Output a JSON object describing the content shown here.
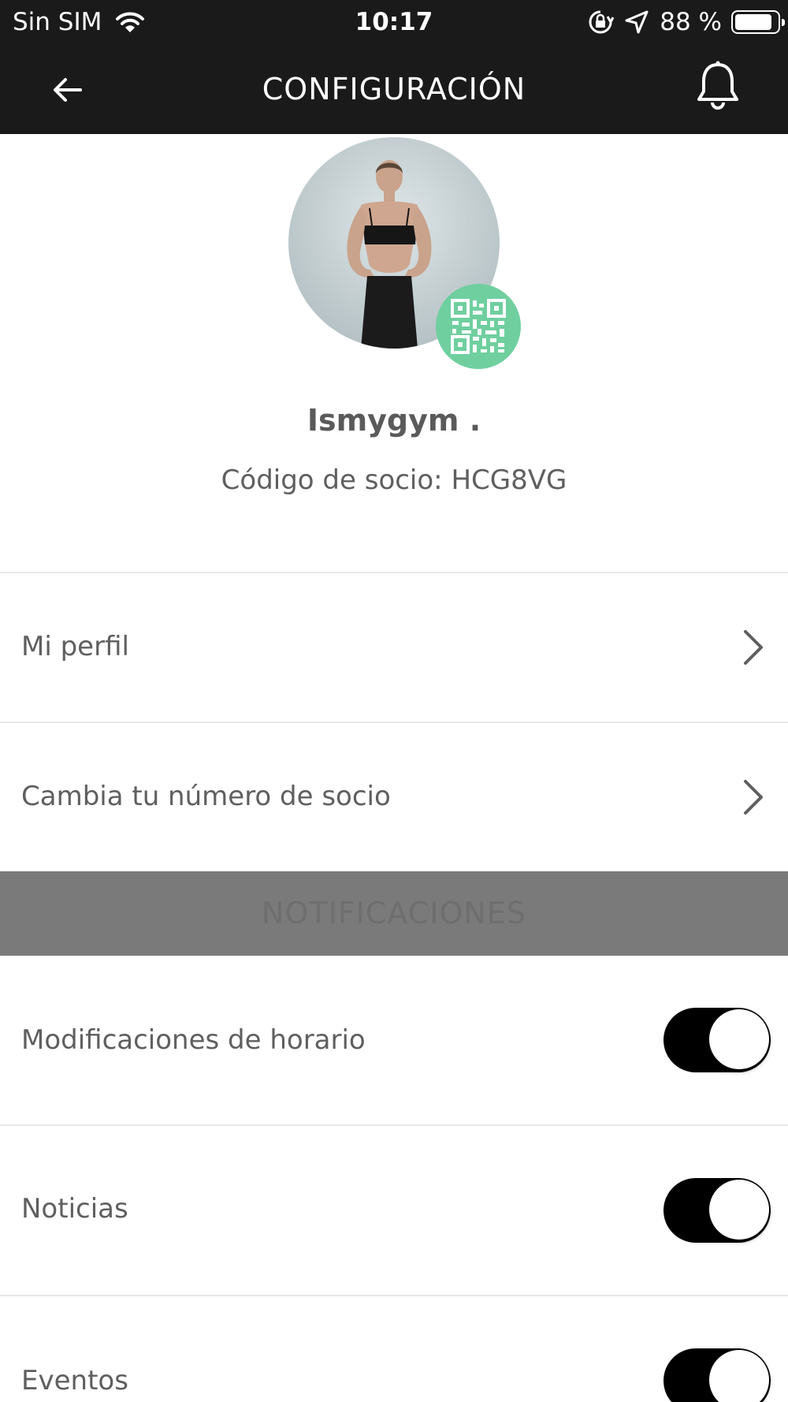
{
  "status_bar": {
    "carrier": "Sin SIM",
    "time": "10:17",
    "battery_percent": "88 %",
    "battery_level": 0.88
  },
  "nav": {
    "title": "CONFIGURACIÓN"
  },
  "profile": {
    "name": "Ismygym .",
    "member_code": "Código de socio: HCG8VG"
  },
  "menu": {
    "items": [
      {
        "label": "Mi perfil"
      },
      {
        "label": "Cambia tu número de socio"
      }
    ]
  },
  "notifications": {
    "section_title": "NOTIFICACIONES",
    "items": [
      {
        "label": "Modificaciones de horario",
        "enabled": true
      },
      {
        "label": "Noticias",
        "enabled": true
      },
      {
        "label": "Eventos",
        "enabled": true
      }
    ]
  },
  "colors": {
    "bar_background": "#1a1a1a",
    "qr_badge": "#6fcf9f",
    "section_header": "#7a7a7a",
    "toggle_on": "#000000"
  }
}
